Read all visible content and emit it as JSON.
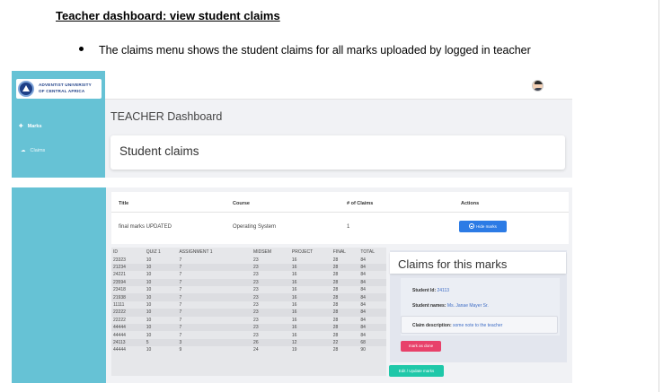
{
  "doc": {
    "heading": "Teacher dashboard: view student claims",
    "bullet": "The claims menu shows the student claims for all marks uploaded by logged in teacher"
  },
  "shot1": {
    "logo_line1": "ADVENTIST UNIVERSITY",
    "logo_line2": "OF CENTRAL AFRICA",
    "nav_marks": "Marks",
    "nav_claims": "Claims",
    "page_title": "TEACHER Dashboard",
    "card_title": "Student claims"
  },
  "shot2": {
    "table_headers": [
      "Title",
      "Course",
      "# of Claims",
      "Actions"
    ],
    "row": {
      "title": "final marks UPDATED",
      "course": "Operating System",
      "claims": "1"
    },
    "hide_marks_button": "Hide marks",
    "marks_headers": [
      "ID",
      "QUIZ 1",
      "ASSIGNMENT 1",
      "MIDSEM",
      "PROJECT",
      "FINAL",
      "TOTAL"
    ],
    "marks_rows": [
      [
        "23323",
        "10",
        "7",
        "23",
        "16",
        "28",
        "84"
      ],
      [
        "21234",
        "10",
        "7",
        "23",
        "16",
        "28",
        "84"
      ],
      [
        "24221",
        "10",
        "7",
        "23",
        "16",
        "28",
        "84"
      ],
      [
        "23594",
        "10",
        "7",
        "23",
        "16",
        "28",
        "84"
      ],
      [
        "23418",
        "10",
        "7",
        "23",
        "16",
        "28",
        "84"
      ],
      [
        "21938",
        "10",
        "7",
        "23",
        "16",
        "28",
        "84"
      ],
      [
        "11111",
        "10",
        "7",
        "23",
        "16",
        "28",
        "84"
      ],
      [
        "22222",
        "10",
        "7",
        "23",
        "16",
        "28",
        "84"
      ],
      [
        "22222",
        "10",
        "7",
        "23",
        "16",
        "28",
        "84"
      ],
      [
        "44444",
        "10",
        "7",
        "23",
        "16",
        "28",
        "84"
      ],
      [
        "44444",
        "10",
        "7",
        "23",
        "16",
        "28",
        "84"
      ],
      [
        "24113",
        "5",
        "3",
        "26",
        "12",
        "22",
        "68"
      ],
      [
        "44444",
        "10",
        "9",
        "24",
        "19",
        "28",
        "90"
      ]
    ],
    "claims_title": "Claims for this marks",
    "student_id_label": "Student Id:",
    "student_id_value": "24113",
    "student_names_label": "Student names:",
    "student_names_value": "Ms. Janae Mayer Sr.",
    "claim_desc_label": "Claim description:",
    "claim_desc_value": "some note to the teacher",
    "mark_done_button": "mark as done",
    "edit_button": "Edit / Update marks"
  },
  "colors": {
    "sidebar": "#66c2d5",
    "primary_button": "#2c7be5",
    "danger_button": "#e8416a",
    "success_button": "#1fc8a9",
    "link_text": "#3f6dc5"
  },
  "icons": [
    "logo-icon",
    "plus-icon",
    "cloud-icon",
    "avatar-icon",
    "minus-circle-icon"
  ]
}
